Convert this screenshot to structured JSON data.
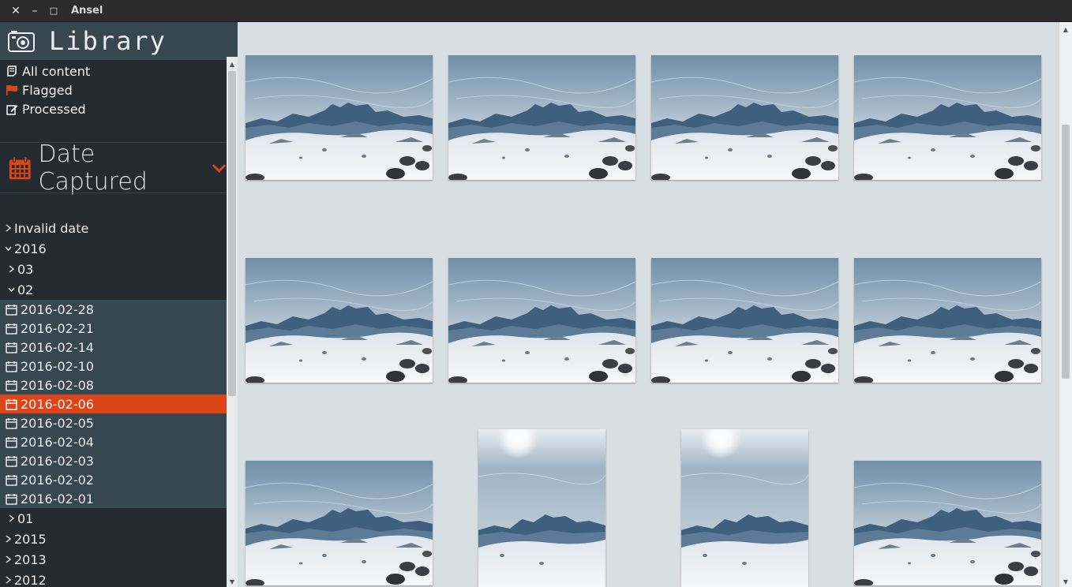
{
  "window": {
    "title": "Ansel",
    "controls": {
      "close": "✕",
      "minimize": "–",
      "maximize": "□"
    }
  },
  "sidebar": {
    "library_title": "Library",
    "library_icon": "camera-icon",
    "quick_items": [
      {
        "label": "All content",
        "icon": "book-icon"
      },
      {
        "label": "Flagged",
        "icon": "flag-icon",
        "icon_color": "#dc4518"
      },
      {
        "label": "Processed",
        "icon": "edit-icon"
      }
    ],
    "date_section": {
      "title": "Date Captured",
      "icon": "calendar-icon",
      "accent": "#dc4518"
    },
    "tree": {
      "invalid": "Invalid date",
      "year_2016": "2016",
      "month_03": "03",
      "month_02": "02",
      "days": [
        "2016-02-28",
        "2016-02-21",
        "2016-02-14",
        "2016-02-10",
        "2016-02-08",
        "2016-02-06",
        "2016-02-05",
        "2016-02-04",
        "2016-02-03",
        "2016-02-02",
        "2016-02-01"
      ],
      "selected_day": "2016-02-06",
      "month_01": "01",
      "year_2015": "2015",
      "year_2013": "2013",
      "year_2012": "2012"
    }
  },
  "colors": {
    "accent": "#dc4518",
    "sidebar_bg": "#242b30",
    "header_bg": "#37474f",
    "grid_bg": "#d8dfe3"
  }
}
